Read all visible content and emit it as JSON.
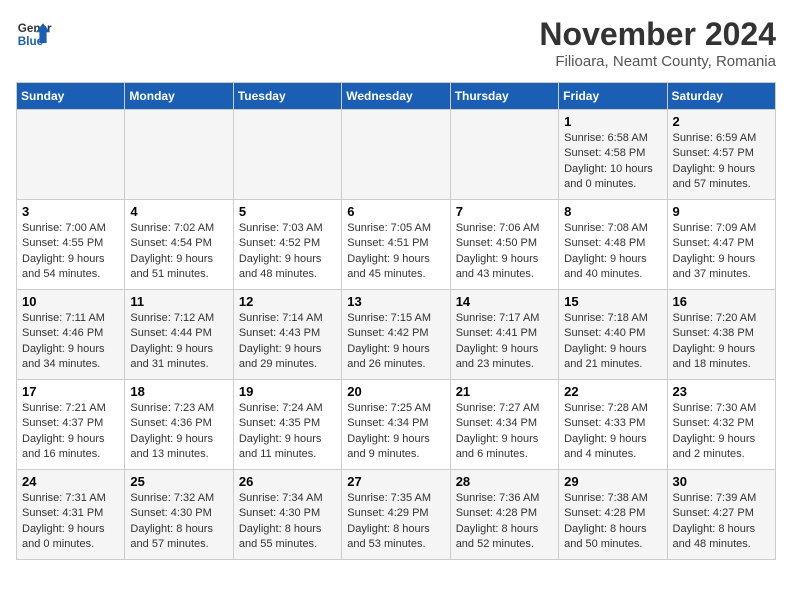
{
  "header": {
    "logo_line1": "General",
    "logo_line2": "Blue",
    "month_title": "November 2024",
    "location": "Filioara, Neamt County, Romania"
  },
  "days_of_week": [
    "Sunday",
    "Monday",
    "Tuesday",
    "Wednesday",
    "Thursday",
    "Friday",
    "Saturday"
  ],
  "weeks": [
    [
      {
        "day": "",
        "info": ""
      },
      {
        "day": "",
        "info": ""
      },
      {
        "day": "",
        "info": ""
      },
      {
        "day": "",
        "info": ""
      },
      {
        "day": "",
        "info": ""
      },
      {
        "day": "1",
        "info": "Sunrise: 6:58 AM\nSunset: 4:58 PM\nDaylight: 10 hours and 0 minutes."
      },
      {
        "day": "2",
        "info": "Sunrise: 6:59 AM\nSunset: 4:57 PM\nDaylight: 9 hours and 57 minutes."
      }
    ],
    [
      {
        "day": "3",
        "info": "Sunrise: 7:00 AM\nSunset: 4:55 PM\nDaylight: 9 hours and 54 minutes."
      },
      {
        "day": "4",
        "info": "Sunrise: 7:02 AM\nSunset: 4:54 PM\nDaylight: 9 hours and 51 minutes."
      },
      {
        "day": "5",
        "info": "Sunrise: 7:03 AM\nSunset: 4:52 PM\nDaylight: 9 hours and 48 minutes."
      },
      {
        "day": "6",
        "info": "Sunrise: 7:05 AM\nSunset: 4:51 PM\nDaylight: 9 hours and 45 minutes."
      },
      {
        "day": "7",
        "info": "Sunrise: 7:06 AM\nSunset: 4:50 PM\nDaylight: 9 hours and 43 minutes."
      },
      {
        "day": "8",
        "info": "Sunrise: 7:08 AM\nSunset: 4:48 PM\nDaylight: 9 hours and 40 minutes."
      },
      {
        "day": "9",
        "info": "Sunrise: 7:09 AM\nSunset: 4:47 PM\nDaylight: 9 hours and 37 minutes."
      }
    ],
    [
      {
        "day": "10",
        "info": "Sunrise: 7:11 AM\nSunset: 4:46 PM\nDaylight: 9 hours and 34 minutes."
      },
      {
        "day": "11",
        "info": "Sunrise: 7:12 AM\nSunset: 4:44 PM\nDaylight: 9 hours and 31 minutes."
      },
      {
        "day": "12",
        "info": "Sunrise: 7:14 AM\nSunset: 4:43 PM\nDaylight: 9 hours and 29 minutes."
      },
      {
        "day": "13",
        "info": "Sunrise: 7:15 AM\nSunset: 4:42 PM\nDaylight: 9 hours and 26 minutes."
      },
      {
        "day": "14",
        "info": "Sunrise: 7:17 AM\nSunset: 4:41 PM\nDaylight: 9 hours and 23 minutes."
      },
      {
        "day": "15",
        "info": "Sunrise: 7:18 AM\nSunset: 4:40 PM\nDaylight: 9 hours and 21 minutes."
      },
      {
        "day": "16",
        "info": "Sunrise: 7:20 AM\nSunset: 4:38 PM\nDaylight: 9 hours and 18 minutes."
      }
    ],
    [
      {
        "day": "17",
        "info": "Sunrise: 7:21 AM\nSunset: 4:37 PM\nDaylight: 9 hours and 16 minutes."
      },
      {
        "day": "18",
        "info": "Sunrise: 7:23 AM\nSunset: 4:36 PM\nDaylight: 9 hours and 13 minutes."
      },
      {
        "day": "19",
        "info": "Sunrise: 7:24 AM\nSunset: 4:35 PM\nDaylight: 9 hours and 11 minutes."
      },
      {
        "day": "20",
        "info": "Sunrise: 7:25 AM\nSunset: 4:34 PM\nDaylight: 9 hours and 9 minutes."
      },
      {
        "day": "21",
        "info": "Sunrise: 7:27 AM\nSunset: 4:34 PM\nDaylight: 9 hours and 6 minutes."
      },
      {
        "day": "22",
        "info": "Sunrise: 7:28 AM\nSunset: 4:33 PM\nDaylight: 9 hours and 4 minutes."
      },
      {
        "day": "23",
        "info": "Sunrise: 7:30 AM\nSunset: 4:32 PM\nDaylight: 9 hours and 2 minutes."
      }
    ],
    [
      {
        "day": "24",
        "info": "Sunrise: 7:31 AM\nSunset: 4:31 PM\nDaylight: 9 hours and 0 minutes."
      },
      {
        "day": "25",
        "info": "Sunrise: 7:32 AM\nSunset: 4:30 PM\nDaylight: 8 hours and 57 minutes."
      },
      {
        "day": "26",
        "info": "Sunrise: 7:34 AM\nSunset: 4:30 PM\nDaylight: 8 hours and 55 minutes."
      },
      {
        "day": "27",
        "info": "Sunrise: 7:35 AM\nSunset: 4:29 PM\nDaylight: 8 hours and 53 minutes."
      },
      {
        "day": "28",
        "info": "Sunrise: 7:36 AM\nSunset: 4:28 PM\nDaylight: 8 hours and 52 minutes."
      },
      {
        "day": "29",
        "info": "Sunrise: 7:38 AM\nSunset: 4:28 PM\nDaylight: 8 hours and 50 minutes."
      },
      {
        "day": "30",
        "info": "Sunrise: 7:39 AM\nSunset: 4:27 PM\nDaylight: 8 hours and 48 minutes."
      }
    ]
  ]
}
